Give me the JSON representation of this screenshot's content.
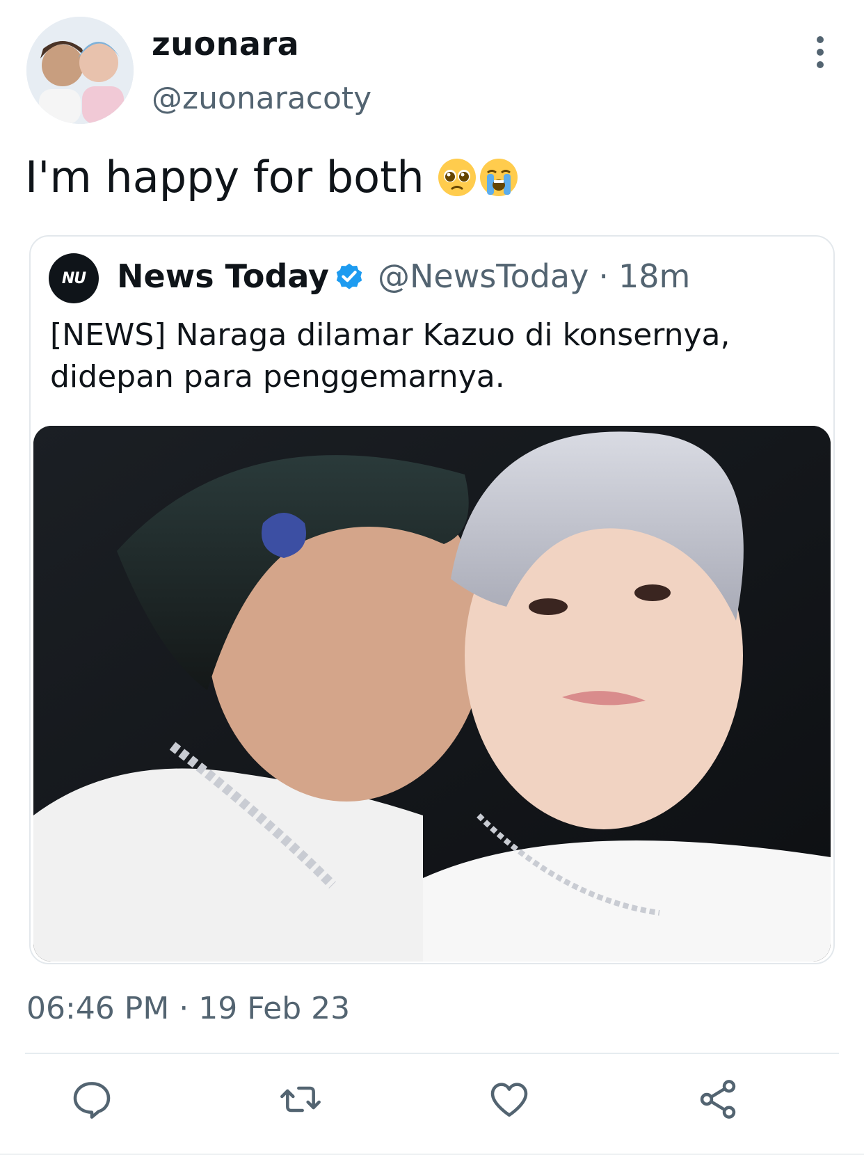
{
  "tweet": {
    "author": {
      "display_name": "zuonara",
      "handle": "@zuonaracoty",
      "avatar_icon": "avatar-photo"
    },
    "text": "I'm happy for both",
    "emojis": [
      "pleading-face-emoji",
      "loudly-crying-face-emoji"
    ],
    "timestamp": "06:46 PM · 19 Feb 23",
    "more_icon": "more-vertical-icon"
  },
  "quote": {
    "logo_text": "NU",
    "name": "News Today",
    "verified_icon": "verified-badge-icon",
    "handle": "@NewsToday",
    "separator": "·",
    "time": "18m",
    "text": "[NEWS] Naraga dilamar Kazuo di konsernya, didepan para penggemarnya.",
    "media_icon": "photo-image"
  },
  "actions": [
    {
      "name": "reply",
      "icon": "reply-icon"
    },
    {
      "name": "retweet",
      "icon": "retweet-icon"
    },
    {
      "name": "like",
      "icon": "heart-icon"
    },
    {
      "name": "share",
      "icon": "share-icon"
    }
  ],
  "colors": {
    "text_primary": "#0f1419",
    "text_secondary": "#536471",
    "verified_blue": "#1d9bf0",
    "border": "#e3e8ec"
  }
}
